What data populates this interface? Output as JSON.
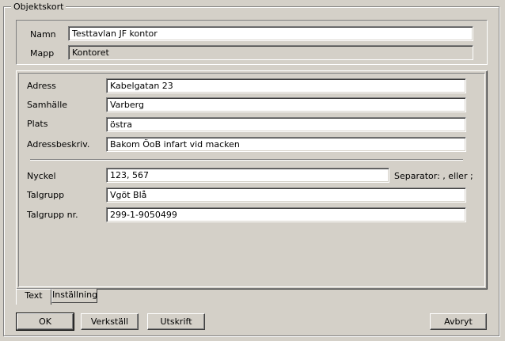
{
  "group_title": "Objektskort",
  "header": {
    "name_label": "Namn",
    "name_value": "Testtavlan JF kontor",
    "folder_label": "Mapp",
    "folder_value": "Kontoret"
  },
  "address": {
    "address_label": "Adress",
    "address_value": "Kabelgatan 23",
    "city_label": "Samhälle",
    "city_value": "Varberg",
    "place_label": "Plats",
    "place_value": "östra",
    "desc_label": "Adressbeskriv.",
    "desc_value": "Bakom ÖoB infart vid macken"
  },
  "details": {
    "key_label": "Nyckel",
    "key_value": "123, 567",
    "separator_hint": "Separator: , eller ;",
    "group_label": "Talgrupp",
    "group_value": "Vgöt Blå",
    "group_nr_label": "Talgrupp nr.",
    "group_nr_value": "299-1-9050499"
  },
  "tabs": [
    {
      "label": "Text",
      "active": true
    },
    {
      "label": "Inställning",
      "active": false
    }
  ],
  "buttons": {
    "ok": "OK",
    "apply": "Verkställ",
    "print": "Utskrift",
    "cancel": "Avbryt"
  }
}
